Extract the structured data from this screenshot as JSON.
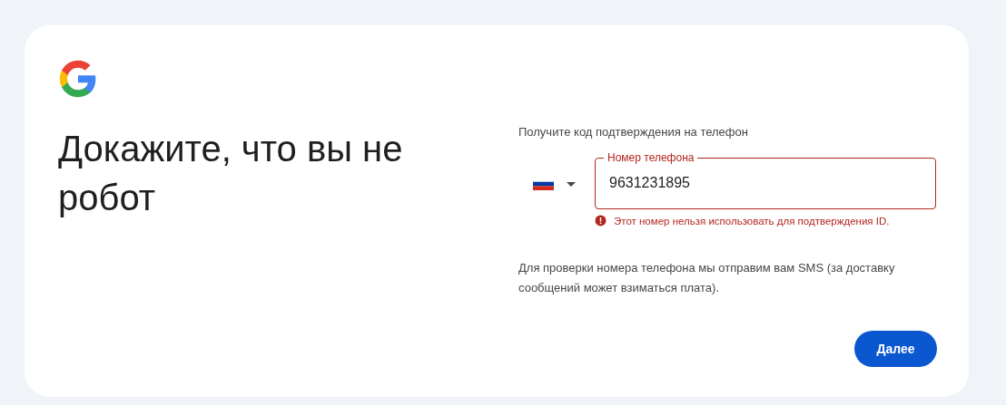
{
  "heading": "Докажите, что вы не робот",
  "subtitle": "Получите код подтверждения на телефон",
  "phone": {
    "label": "Номер телефона",
    "value": "9631231895",
    "invalid": true
  },
  "error_message": "Этот номер нельзя использовать для подтверждения ID.",
  "hint": "Для проверки номера телефона мы отправим вам SMS (за доставку сообщений может взиматься плата).",
  "next_button": "Далее"
}
